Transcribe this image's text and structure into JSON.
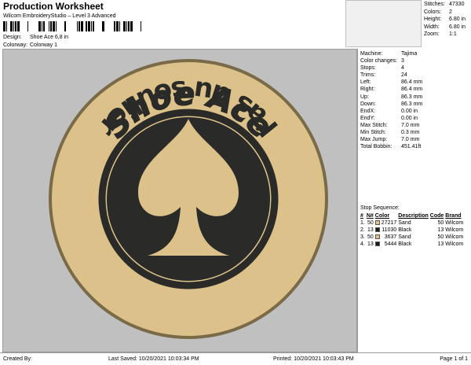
{
  "header": {
    "title": "Production Worksheet",
    "software": "Wilcom EmbroideryStudio – Level 3 Advanced",
    "design_label": "Design:",
    "design_value": "Shoe Ace 6,8 in",
    "colorway_label": "Colorway:",
    "colorway_value": "Colorway 1"
  },
  "stats": [
    {
      "label": "Stitches:",
      "value": "47330"
    },
    {
      "label": "Colors:",
      "value": "2"
    },
    {
      "label": "Height:",
      "value": "6.80 in"
    },
    {
      "label": "Width:",
      "value": "6.80 in"
    },
    {
      "label": "Zoom:",
      "value": "1:1"
    }
  ],
  "design": {
    "top_text": "Shoe Ace",
    "bottom_text": "l'as du soulier",
    "fill_color": "#dcc28a",
    "dark_color": "#2a2a28",
    "bg_color": "#c0c0c0"
  },
  "params": [
    {
      "label": "Machine:",
      "value": "Tajima"
    },
    {
      "label": "Color changes:",
      "value": "3"
    },
    {
      "label": "Stops:",
      "value": "4"
    },
    {
      "label": "Trims:",
      "value": "24"
    },
    {
      "label": "Left:",
      "value": "86.4 mm"
    },
    {
      "label": "Right:",
      "value": "86.4 mm"
    },
    {
      "label": "Up:",
      "value": "86.3 mm"
    },
    {
      "label": "Down:",
      "value": "86.3 mm"
    },
    {
      "label": "EndX:",
      "value": "0.00 in"
    },
    {
      "label": "EndY:",
      "value": "0.00 in"
    },
    {
      "label": "Max Stitch:",
      "value": "7.0 mm"
    },
    {
      "label": "Min Stitch:",
      "value": "0.3 mm"
    },
    {
      "label": "Max Jump:",
      "value": "7.0 mm"
    },
    {
      "label": "Total Bobbin:",
      "value": "451.41ft"
    }
  ],
  "sequence": {
    "title": "Stop Sequence:",
    "headers": [
      "#",
      "N#",
      "Color",
      "Description",
      "Code",
      "Brand"
    ],
    "rows": [
      {
        "n": "1.",
        "needle": "50",
        "swatch": "#e6c08a",
        "stitches": "27217",
        "desc": "Sand",
        "code": "50",
        "brand": "Wilcom"
      },
      {
        "n": "2.",
        "needle": "13",
        "swatch": "#1a1a1a",
        "stitches": "11030",
        "desc": "Black",
        "code": "13",
        "brand": "Wilcom"
      },
      {
        "n": "3.",
        "needle": "50",
        "swatch": "#e6c08a",
        "stitches": "3637",
        "desc": "Sand",
        "code": "50",
        "brand": "Wilcom"
      },
      {
        "n": "4.",
        "needle": "13",
        "swatch": "#1a1a1a",
        "stitches": "5444",
        "desc": "Black",
        "code": "13",
        "brand": "Wilcom"
      }
    ]
  },
  "footer": {
    "created": "Created By:",
    "saved": "Last Saved: 10/20/2021 10:03:34 PM",
    "printed": "Printed: 10/20/2021 10:03:43 PM",
    "page": "Page 1 of 1"
  }
}
